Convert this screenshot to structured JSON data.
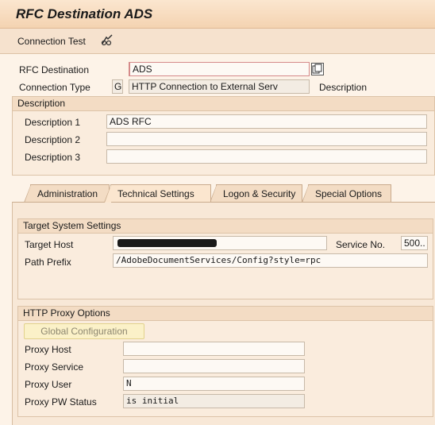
{
  "window": {
    "title": "RFC Destination ADS"
  },
  "toolbar": {
    "connection_test_label": "Connection Test",
    "connection_test_icon": "glasses-check-icon"
  },
  "header": {
    "rfc_destination_label": "RFC Destination",
    "rfc_destination_value": "ADS",
    "connection_type_label": "Connection Type",
    "connection_type_code": "G",
    "connection_type_text": "HTTP Connection to External Serv",
    "description_label": "Description"
  },
  "description": {
    "group_title": "Description",
    "fields": [
      {
        "label": "Description 1",
        "value": "ADS RFC"
      },
      {
        "label": "Description 2",
        "value": ""
      },
      {
        "label": "Description 3",
        "value": ""
      }
    ]
  },
  "tabs": [
    {
      "label": "Administration",
      "active": false
    },
    {
      "label": "Technical Settings",
      "active": true
    },
    {
      "label": "Logon & Security",
      "active": false
    },
    {
      "label": "Special Options",
      "active": false
    }
  ],
  "target_system": {
    "group_title": "Target System Settings",
    "target_host_label": "Target Host",
    "target_host_value": "",
    "service_no_label": "Service No.",
    "service_no_value": "500..",
    "path_prefix_label": "Path Prefix",
    "path_prefix_value": "/AdobeDocumentServices/Config?style=rpc"
  },
  "proxy": {
    "group_title": "HTTP Proxy Options",
    "global_config_label": "Global Configuration",
    "fields": [
      {
        "label": "Proxy Host",
        "value": ""
      },
      {
        "label": "Proxy Service",
        "value": ""
      },
      {
        "label": "Proxy User",
        "value": "N"
      },
      {
        "label": "Proxy PW Status",
        "value": "is initial"
      }
    ]
  },
  "colors": {
    "required_marker": "#cc2222",
    "title_bg": "#f4d3b1",
    "panel_bg": "#f8e8d7"
  }
}
